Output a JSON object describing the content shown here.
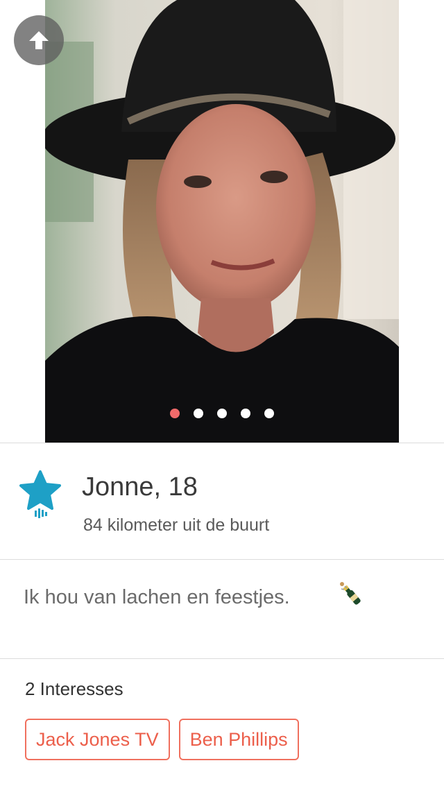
{
  "profile": {
    "name": "Jonne",
    "age_text": ", 18",
    "distance": "84 kilometer uit de buurt",
    "bio": "Ik hou van lachen en feestjes.",
    "bio_emoji": "bottle-with-popping-cork-icon"
  },
  "photos": {
    "count": 5,
    "active_index": 0
  },
  "interests": {
    "title": "2 Interesses",
    "items": [
      "Jack Jones TV",
      "Ben Phillips"
    ]
  },
  "icons": {
    "back": "arrow-up-icon",
    "badge": "star-voice-icon"
  },
  "colors": {
    "accent": "#f06a6a",
    "star": "#1ea0c6",
    "chip_border": "#f0705e",
    "chip_text": "#ec5f4b"
  }
}
